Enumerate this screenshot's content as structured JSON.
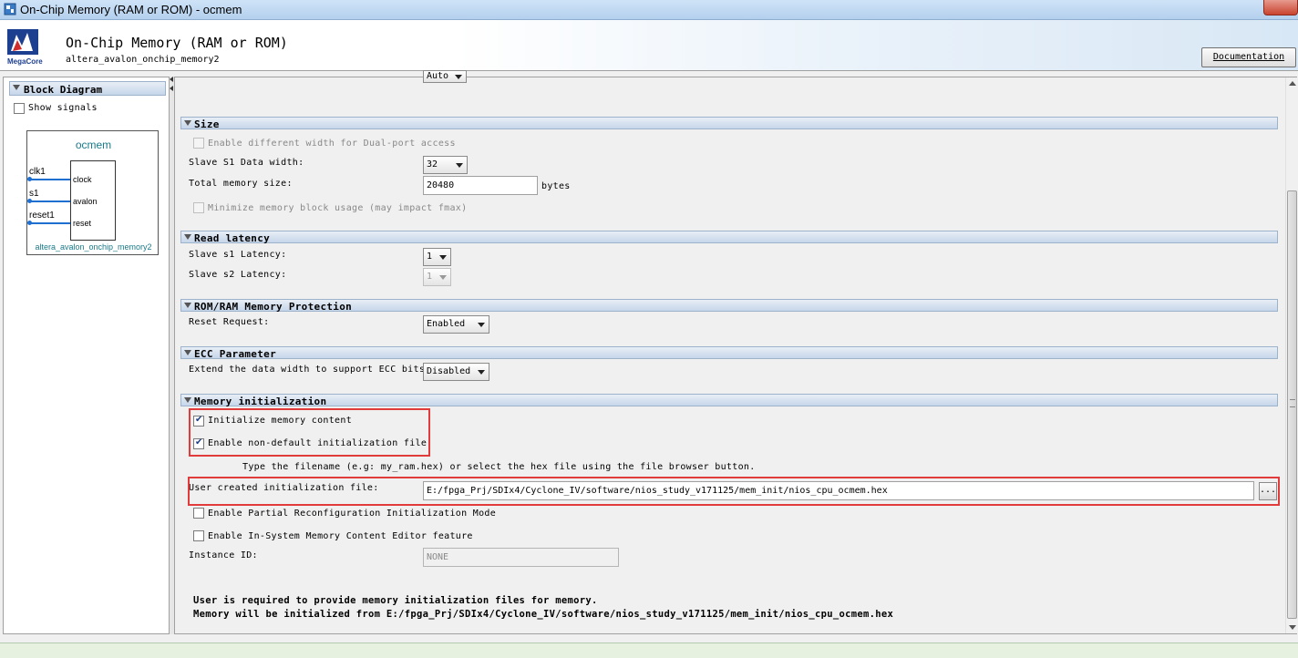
{
  "window": {
    "title": "On-Chip Memory (RAM or ROM) - ocmem"
  },
  "header": {
    "title": "On-Chip Memory (RAM or ROM)",
    "subtitle": "altera_avalon_onchip_memory2",
    "logo_text": "MegaCore",
    "documentation_label": "Documentation"
  },
  "block_diagram": {
    "heading": "Block Diagram",
    "show_signals_label": "Show signals",
    "show_signals_checked": false,
    "component_name": "ocmem",
    "component_type": "altera_avalon_onchip_memory2",
    "signals": [
      "clk1",
      "s1",
      "reset1"
    ],
    "ports": [
      "clock",
      "avalon",
      "reset"
    ]
  },
  "type_section": {
    "partial_value": "Auto"
  },
  "size": {
    "heading": "Size",
    "dual_port_label": "Enable different width for Dual-port access",
    "data_width_label": "Slave S1 Data width:",
    "data_width_value": "32",
    "total_size_label": "Total memory size:",
    "total_size_value": "20480",
    "total_size_unit": "bytes",
    "minimize_label": "Minimize memory block usage (may impact fmax)"
  },
  "read_latency": {
    "heading": "Read latency",
    "s1_label": "Slave s1 Latency:",
    "s1_value": "1",
    "s2_label": "Slave s2 Latency:",
    "s2_value": "1"
  },
  "protection": {
    "heading": "ROM/RAM Memory Protection",
    "reset_label": "Reset Request:",
    "reset_value": "Enabled"
  },
  "ecc": {
    "heading": "ECC Parameter",
    "extend_label": "Extend the data width to support ECC bits:",
    "extend_value": "Disabled"
  },
  "mem_init": {
    "heading": "Memory initialization",
    "init_content_label": "Initialize memory content",
    "init_content_checked": true,
    "non_default_label": "Enable non-default initialization file",
    "non_default_checked": true,
    "hint": "Type the filename (e.g: my_ram.hex) or select the hex file using the file browser button.",
    "file_label": "User created initialization file:",
    "file_value": "E:/fpga_Prj/SDIx4/Cyclone_IV/software/nios_study_v171125/mem_init/nios_cpu_ocmem.hex",
    "browse_label": "...",
    "partial_reconfig_label": "Enable Partial Reconfiguration Initialization Mode",
    "partial_reconfig_checked": false,
    "insystem_label": "Enable In-System Memory Content Editor feature",
    "insystem_checked": false,
    "instance_id_label": "Instance ID:",
    "instance_id_value": "NONE"
  },
  "messages": {
    "line1": "User is required to provide memory initialization files for memory.",
    "line2": "Memory will be initialized from E:/fpga_Prj/SDIx4/Cyclone_IV/software/nios_study_v171125/mem_init/nios_cpu_ocmem.hex"
  },
  "colors": {
    "highlight": "#e23b3b",
    "section_header": "#c6d6ea",
    "diagram_accent": "#1a7a8a",
    "wire": "#1f6fd0"
  }
}
